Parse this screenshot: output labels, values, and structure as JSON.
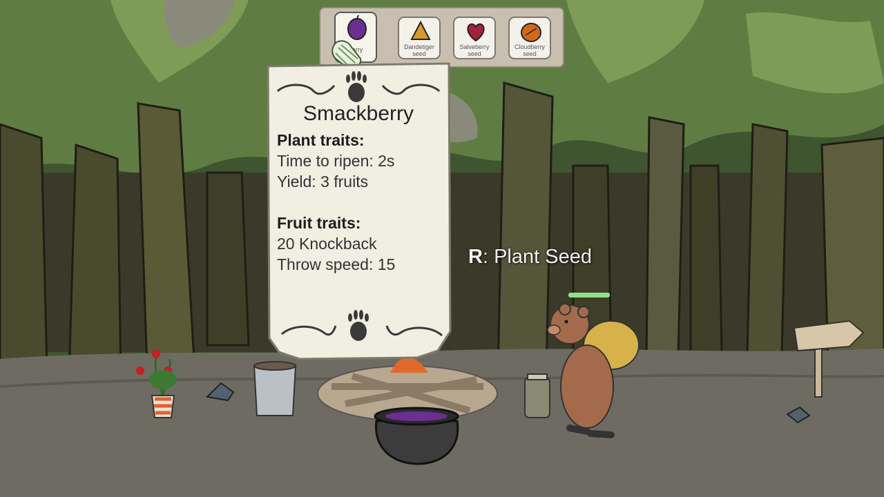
{
  "seed_bar": {
    "slots": [
      {
        "name": "Smackberry seed",
        "label_line1": "berry",
        "label_line2": "d",
        "selected": true,
        "color": "#6b2f8f"
      },
      {
        "name": "Dandetiger seed",
        "label_line1": "Dandetiger",
        "label_line2": "seed",
        "selected": false,
        "color": "#d89a2a"
      },
      {
        "name": "Salveberry seed",
        "label_line1": "Salveberry",
        "label_line2": "seed",
        "selected": false,
        "color": "#a3243a"
      },
      {
        "name": "Cloudberry seed",
        "label_line1": "Cloudberry",
        "label_line2": "seed",
        "selected": false,
        "color": "#d06a18"
      }
    ]
  },
  "tooltip": {
    "title": "Smackberry",
    "plant_traits_heading": "Plant traits:",
    "time_to_ripen": "Time to ripen: 2s",
    "yield": "Yield: 3 fruits",
    "fruit_traits_heading": "Fruit traits:",
    "knockback": "20 Knockback",
    "throw_speed": "Throw speed: 15"
  },
  "prompt": {
    "key": "R",
    "action": ": Plant Seed"
  },
  "player": {
    "health_fraction": 1.0
  },
  "colors": {
    "forest_dark": "#2f3a22",
    "forest_light": "#6d8a4a",
    "ground": "#6e6c62",
    "card": "#f1eee2",
    "health": "#8fe08a"
  }
}
